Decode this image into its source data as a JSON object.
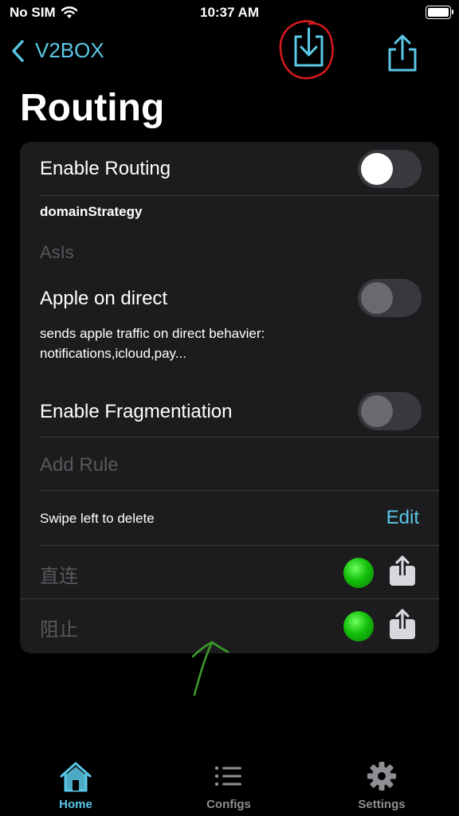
{
  "status": {
    "carrier": "No SIM",
    "time": "10:37 AM"
  },
  "nav": {
    "back_label": "V2BOX"
  },
  "page": {
    "title": "Routing"
  },
  "settings": {
    "enable_routing": {
      "label": "Enable Routing",
      "on": true
    },
    "domain_strategy": {
      "header": "domainStrategy",
      "value": "AsIs"
    },
    "apple_direct": {
      "label": "Apple on direct",
      "description_line1": "sends apple traffic on direct behavier:",
      "description_line2": "notifications,icloud,pay...",
      "on": false
    },
    "fragmentation": {
      "label": "Enable Fragmentiation",
      "on": false
    },
    "add_rule": "Add Rule",
    "swipe_hint": "Swipe left to delete",
    "edit_label": "Edit",
    "rules": [
      {
        "name": "直连",
        "status_color": "#1ec012"
      },
      {
        "name": "阻止",
        "status_color": "#1ec012"
      }
    ]
  },
  "tabs": [
    {
      "label": "Home",
      "icon": "home-icon",
      "active": true
    },
    {
      "label": "Configs",
      "icon": "list-icon",
      "active": false
    },
    {
      "label": "Settings",
      "icon": "gear-icon",
      "active": false
    }
  ],
  "colors": {
    "accent": "#5ac8e6",
    "card": "#1c1c1e",
    "annotation_red": "#d4191f",
    "annotation_green": "#3a9a2a"
  }
}
